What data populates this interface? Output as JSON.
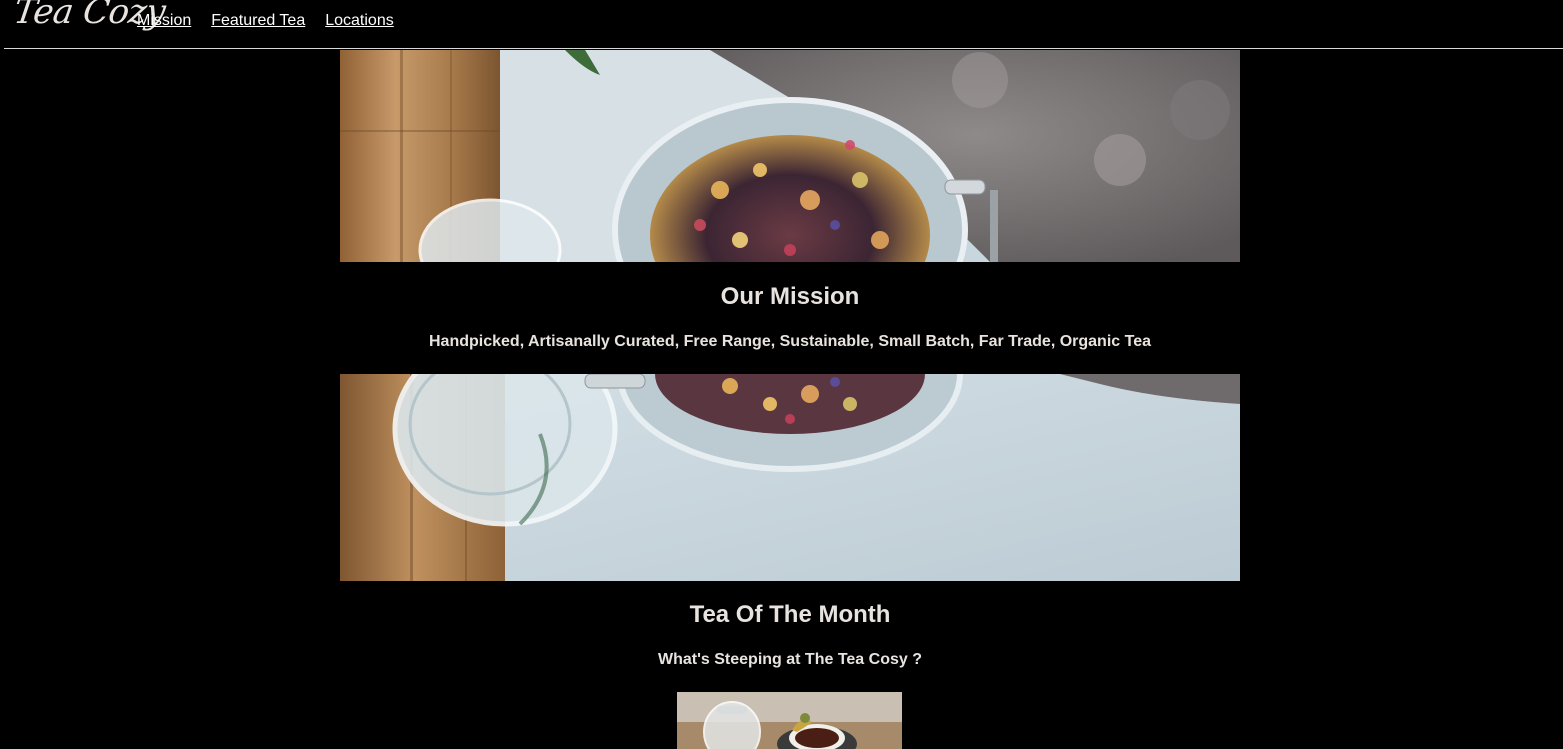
{
  "header": {
    "logo_text": "Tea Cozy",
    "nav": [
      {
        "label": "Mission"
      },
      {
        "label": "Featured Tea"
      },
      {
        "label": "Locations"
      }
    ]
  },
  "mission": {
    "title": "Our Mission",
    "subtitle": "Handpicked, Artisanally Curated, Free Range, Sustainable, Small Batch, Far Trade, Organic Tea"
  },
  "tea_of_month": {
    "title": "Tea Of The Month",
    "subtitle": "What's Steeping at The Tea Cosy ?"
  },
  "colors": {
    "background": "#000000",
    "text": "#e8e3de",
    "link": "#ffffff"
  }
}
